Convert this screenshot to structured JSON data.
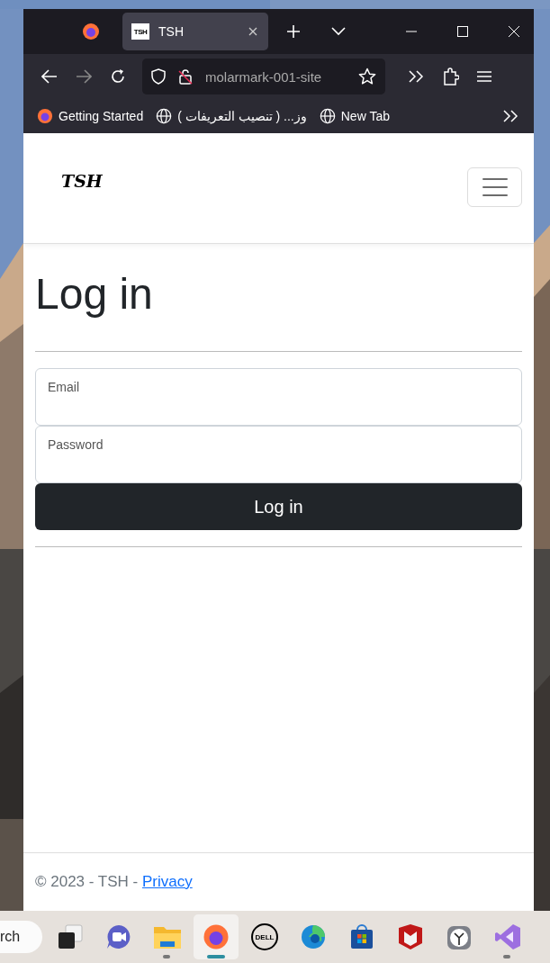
{
  "browser": {
    "tabs": [
      {
        "title": "TSH",
        "favicon": "TSH",
        "selected": true
      }
    ],
    "address": "molarmark-001-site",
    "bookmarks": [
      {
        "kind": "firefox",
        "label": "Getting Started"
      },
      {
        "kind": "globe",
        "label": "وز... ( تنصيب التعريفات )"
      },
      {
        "kind": "globe",
        "label": "New Tab"
      }
    ]
  },
  "page": {
    "brand": "TSH",
    "heading": "Log in",
    "fields": [
      {
        "placeholder": "Email"
      },
      {
        "placeholder": "Password"
      }
    ],
    "submit": "Log in",
    "footer": {
      "text": "© 2023 - TSH - ",
      "link": "Privacy"
    }
  },
  "taskbar": {
    "search": "rch",
    "items": [
      {
        "kind": "taskview",
        "running": false,
        "selected": false
      },
      {
        "kind": "meet",
        "running": false,
        "selected": false
      },
      {
        "kind": "folder",
        "running": true,
        "selected": false
      },
      {
        "kind": "firefox",
        "running": true,
        "selected": true
      },
      {
        "kind": "dell",
        "label": "DELL",
        "running": false,
        "selected": false
      },
      {
        "kind": "edge",
        "running": false,
        "selected": false
      },
      {
        "kind": "store",
        "running": false,
        "selected": false
      },
      {
        "kind": "mcafee",
        "running": false,
        "selected": false
      },
      {
        "kind": "clock",
        "running": false,
        "selected": false
      },
      {
        "kind": "vs",
        "running": true,
        "selected": false
      }
    ]
  }
}
